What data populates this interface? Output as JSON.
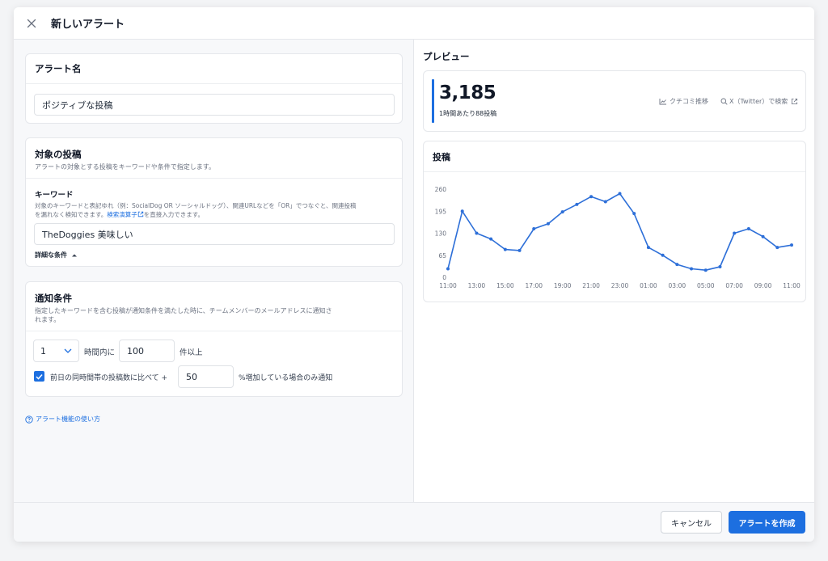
{
  "header": {
    "title": "新しいアラート"
  },
  "alert_name": {
    "section_title": "アラート名",
    "value": "ポジティブな投稿"
  },
  "target": {
    "section_title": "対象の投稿",
    "description": "アラートの対象とする投稿をキーワードや条件で指定します。",
    "keyword_label": "キーワード",
    "keyword_help_1": "対象のキーワードと表記ゆれ（例：SocialDog OR ソーシャルドッグ）、関連URLなどを「OR」でつなぐと、関連投稿",
    "keyword_help_2": "を漏れなく検知できます。",
    "keyword_help_link": "検索演算子",
    "keyword_help_3": "を直接入力できます。",
    "keyword_value": "TheDoggies 美味しい",
    "advanced_label": "詳細な条件"
  },
  "notify": {
    "section_title": "通知条件",
    "description_1": "指定したキーワードを含む投稿が通知条件を満たした時に、チームメンバーのメールアドレスに通知さ",
    "description_2": "れます。",
    "hours_value": "1",
    "hours_suffix": "時間内に",
    "count_value": "100",
    "count_suffix": "件以上",
    "compare_checked": true,
    "compare_label": "前日の同時間帯の投稿数に比べて +",
    "percent_value": "50",
    "percent_suffix": "%増加している場合のみ通知"
  },
  "help_link": "アラート機能の使い方",
  "preview": {
    "title": "プレビュー",
    "total": "3,185",
    "rate": "1時間あたり88投稿",
    "trend_link": "クチコミ推移",
    "search_link": "X（Twitter）で検索",
    "accent_color": "#1d6fe0"
  },
  "chart_data": {
    "type": "line",
    "title": "投稿",
    "yticks": [
      "260",
      "195",
      "130",
      "65",
      "0"
    ],
    "ylim": [
      0,
      260
    ],
    "xticks": [
      "11:00",
      "13:00",
      "15:00",
      "17:00",
      "19:00",
      "21:00",
      "23:00",
      "01:00",
      "03:00",
      "05:00",
      "07:00",
      "09:00",
      "11:00"
    ],
    "values": [
      25,
      195,
      130,
      113,
      82,
      79,
      143,
      158,
      193,
      215,
      238,
      223,
      247,
      188,
      88,
      65,
      38,
      25,
      21,
      31,
      130,
      143,
      120,
      88,
      95
    ],
    "grid": "none",
    "line_color": "#2d6fd8"
  },
  "footer": {
    "cancel_label": "キャンセル",
    "create_label": "アラートを作成"
  }
}
